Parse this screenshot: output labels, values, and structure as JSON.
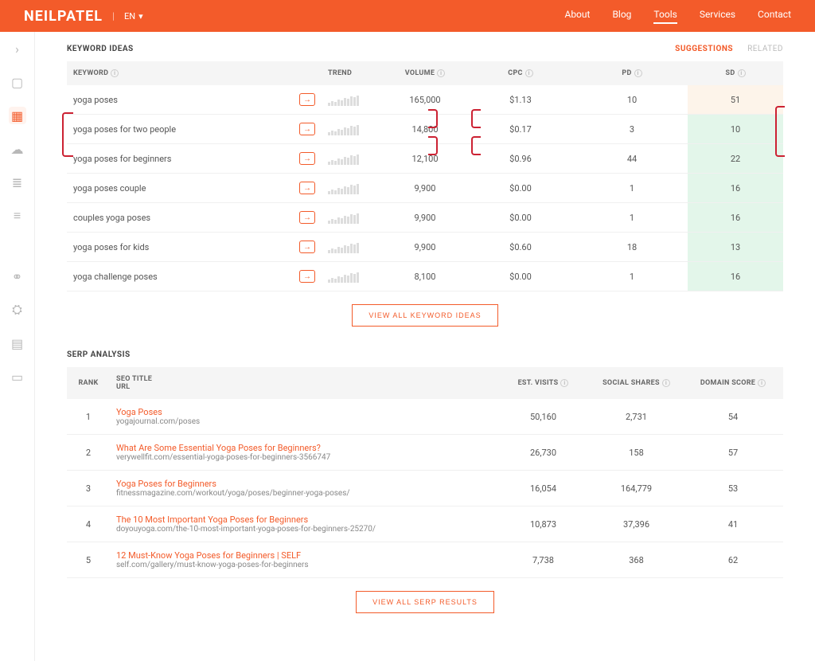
{
  "brand": "NEILPATEL",
  "lang": "EN",
  "topnav": [
    "About",
    "Blog",
    "Tools",
    "Services",
    "Contact"
  ],
  "topnav_active": 2,
  "keyword_ideas": {
    "title": "KEYWORD IDEAS",
    "tabs": [
      "SUGGESTIONS",
      "RELATED"
    ],
    "active_tab": 0,
    "columns": [
      "KEYWORD",
      "TREND",
      "VOLUME",
      "CPC",
      "PD",
      "SD"
    ],
    "rows": [
      {
        "keyword": "yoga poses",
        "volume": "165,000",
        "cpc": "$1.13",
        "pd": "10",
        "sd": "51",
        "sd_class": "warn"
      },
      {
        "keyword": "yoga poses for two people",
        "volume": "14,800",
        "cpc": "$0.17",
        "pd": "3",
        "sd": "10",
        "sd_class": "easy"
      },
      {
        "keyword": "yoga poses for beginners",
        "volume": "12,100",
        "cpc": "$0.96",
        "pd": "44",
        "sd": "22",
        "sd_class": "easy"
      },
      {
        "keyword": "yoga poses couple",
        "volume": "9,900",
        "cpc": "$0.00",
        "pd": "1",
        "sd": "16",
        "sd_class": "easy"
      },
      {
        "keyword": "couples yoga poses",
        "volume": "9,900",
        "cpc": "$0.00",
        "pd": "1",
        "sd": "16",
        "sd_class": "easy"
      },
      {
        "keyword": "yoga poses for kids",
        "volume": "9,900",
        "cpc": "$0.60",
        "pd": "18",
        "sd": "13",
        "sd_class": "easy"
      },
      {
        "keyword": "yoga challenge poses",
        "volume": "8,100",
        "cpc": "$0.00",
        "pd": "1",
        "sd": "16",
        "sd_class": "easy"
      }
    ],
    "view_all": "VIEW ALL KEYWORD IDEAS"
  },
  "serp": {
    "title": "SERP ANALYSIS",
    "columns": {
      "rank": "RANK",
      "title": "SEO TITLE",
      "url": "URL",
      "visits": "EST. VISITS",
      "shares": "SOCIAL SHARES",
      "score": "DOMAIN SCORE"
    },
    "rows": [
      {
        "rank": "1",
        "title": "Yoga Poses",
        "url": "yogajournal.com/poses",
        "visits": "50,160",
        "shares": "2,731",
        "score": "54"
      },
      {
        "rank": "2",
        "title": "What Are Some Essential Yoga Poses for Beginners?",
        "url": "verywellfit.com/essential-yoga-poses-for-beginners-3566747",
        "visits": "26,730",
        "shares": "158",
        "score": "57"
      },
      {
        "rank": "3",
        "title": "Yoga Poses for Beginners",
        "url": "fitnessmagazine.com/workout/yoga/poses/beginner-yoga-poses/",
        "visits": "16,054",
        "shares": "164,779",
        "score": "53"
      },
      {
        "rank": "4",
        "title": "The 10 Most Important Yoga Poses for Beginners",
        "url": "doyouyoga.com/the-10-most-important-yoga-poses-for-beginners-25270/",
        "visits": "10,873",
        "shares": "37,396",
        "score": "41"
      },
      {
        "rank": "5",
        "title": "12 Must-Know Yoga Poses for Beginners | SELF",
        "url": "self.com/gallery/must-know-yoga-poses-for-beginners",
        "visits": "7,738",
        "shares": "368",
        "score": "62"
      }
    ],
    "view_all": "VIEW ALL SERP RESULTS"
  }
}
